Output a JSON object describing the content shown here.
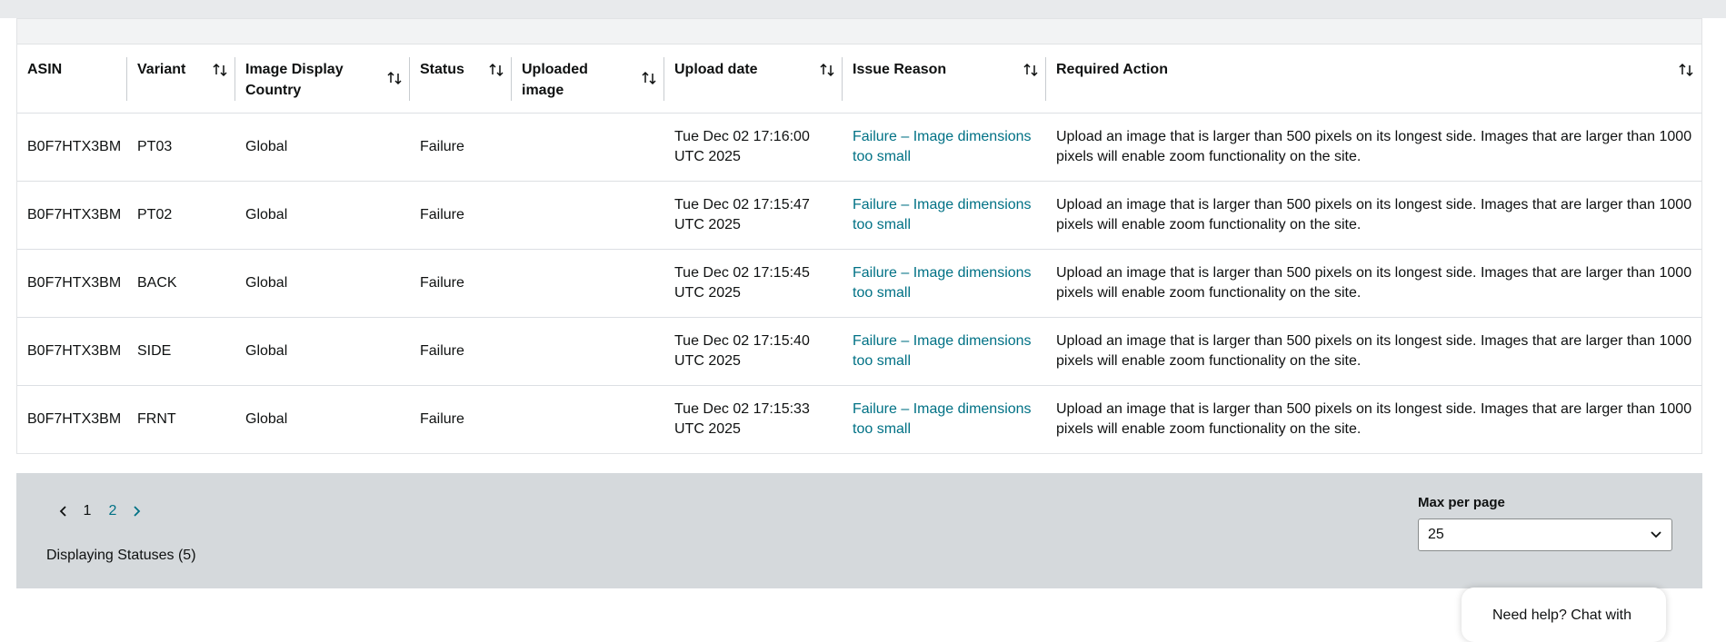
{
  "table": {
    "columns": [
      {
        "label": "ASIN",
        "sortable": false
      },
      {
        "label": "Variant",
        "sortable": true
      },
      {
        "label": "Image Display Country",
        "sortable": true
      },
      {
        "label": "Status",
        "sortable": true
      },
      {
        "label": "Uploaded image",
        "sortable": true
      },
      {
        "label": "Upload date",
        "sortable": true
      },
      {
        "label": "Issue Reason",
        "sortable": true
      },
      {
        "label": "Required Action",
        "sortable": true
      }
    ],
    "rows": [
      {
        "asin": "B0F7HTX3BM",
        "variant": "PT03",
        "country": "Global",
        "status": "Failure",
        "uploaded_image": "",
        "upload_date": "Tue Dec 02 17:16:00 UTC 2025",
        "issue": "Failure – Image dimensions too small",
        "action": "Upload an image that is larger than 500 pixels on its longest side. Images that are larger than 1000 pixels will enable zoom functionality on the site."
      },
      {
        "asin": "B0F7HTX3BM",
        "variant": "PT02",
        "country": "Global",
        "status": "Failure",
        "uploaded_image": "",
        "upload_date": "Tue Dec 02 17:15:47 UTC 2025",
        "issue": "Failure – Image dimensions too small",
        "action": "Upload an image that is larger than 500 pixels on its longest side. Images that are larger than 1000 pixels will enable zoom functionality on the site."
      },
      {
        "asin": "B0F7HTX3BM",
        "variant": "BACK",
        "country": "Global",
        "status": "Failure",
        "uploaded_image": "",
        "upload_date": "Tue Dec 02 17:15:45 UTC 2025",
        "issue": "Failure – Image dimensions too small",
        "action": "Upload an image that is larger than 500 pixels on its longest side. Images that are larger than 1000 pixels will enable zoom functionality on the site."
      },
      {
        "asin": "B0F7HTX3BM",
        "variant": "SIDE",
        "country": "Global",
        "status": "Failure",
        "uploaded_image": "",
        "upload_date": "Tue Dec 02 17:15:40 UTC 2025",
        "issue": "Failure – Image dimensions too small",
        "action": "Upload an image that is larger than 500 pixels on its longest side. Images that are larger than 1000 pixels will enable zoom functionality on the site."
      },
      {
        "asin": "B0F7HTX3BM",
        "variant": "FRNT",
        "country": "Global",
        "status": "Failure",
        "uploaded_image": "",
        "upload_date": "Tue Dec 02 17:15:33 UTC 2025",
        "issue": "Failure – Image dimensions too small",
        "action": "Upload an image that is larger than 500 pixels on its longest side. Images that are larger than 1000 pixels will enable zoom functionality on the site."
      }
    ]
  },
  "pagination": {
    "pages": [
      "1",
      "2"
    ],
    "current_page": "1",
    "prev_icon": "chevron-left-icon",
    "next_icon": "chevron-right-icon"
  },
  "footer": {
    "displaying_text": "Displaying Statuses (5)",
    "max_per_page_label": "Max per page",
    "max_per_page_value": "25"
  },
  "help_chat": {
    "text": "Need help? Chat with"
  },
  "colors": {
    "link": "#007185",
    "footer_bg": "#d5d9dc",
    "text": "#0f1111"
  }
}
